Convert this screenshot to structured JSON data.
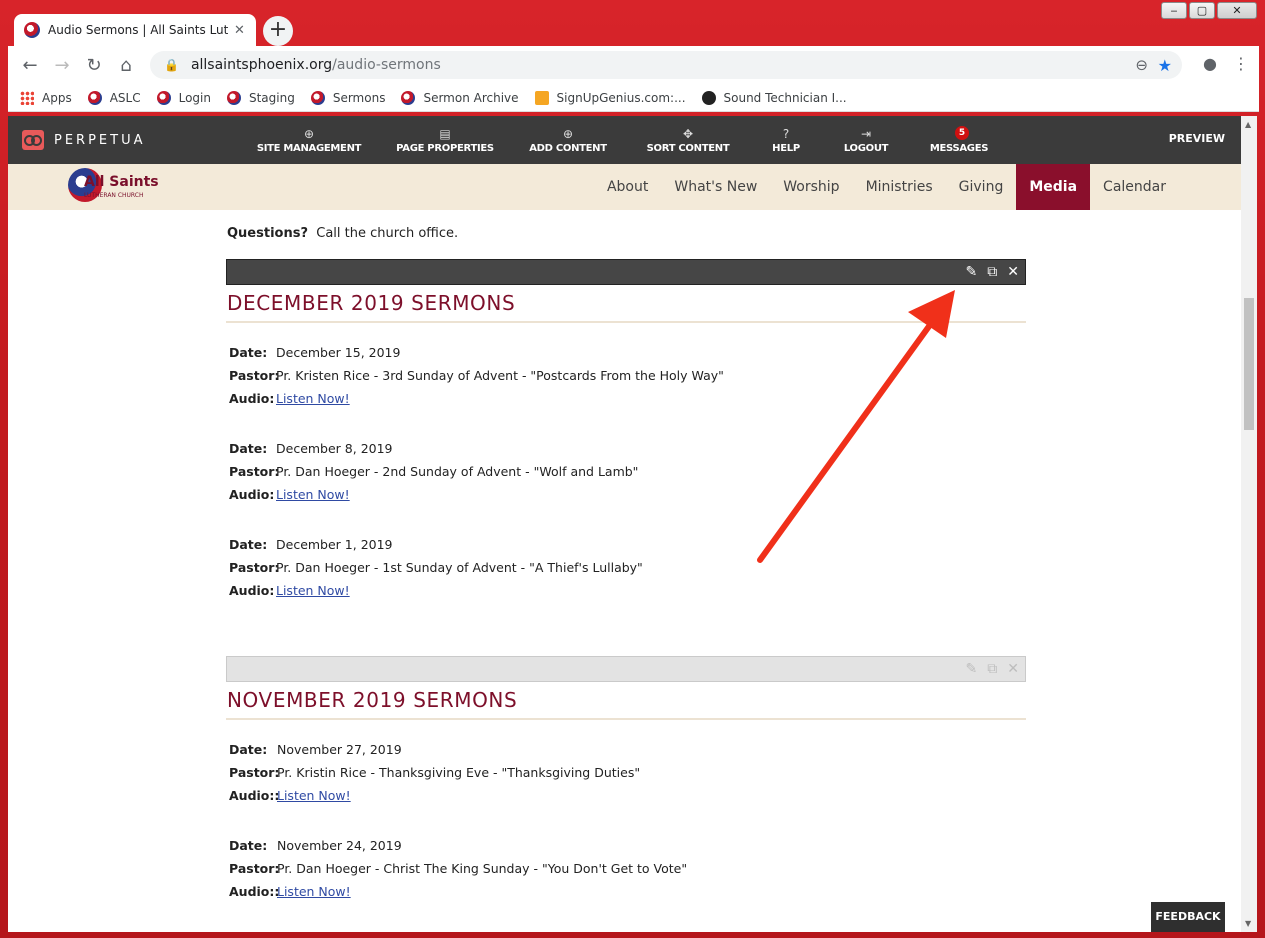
{
  "browser": {
    "tab_title": "Audio Sermons | All Saints Luthe",
    "tab_close": "✕",
    "new_tab": "+",
    "url_host": "allsaintsphoenix.org",
    "url_path": "/audio-sermons",
    "window_controls": [
      "‒",
      "▢",
      "✕"
    ],
    "bookmarks": [
      "Apps",
      "ASLC",
      "Login",
      "Staging",
      "Sermons",
      "Sermon Archive",
      "SignUpGenius.com:...",
      "Sound Technician I..."
    ]
  },
  "cms": {
    "logo_text": "PERPETUA",
    "nav": [
      {
        "icon": "⊕",
        "label": "SITE MANAGEMENT"
      },
      {
        "icon": "▤",
        "label": "PAGE PROPERTIES"
      },
      {
        "icon": "⊕",
        "label": "ADD CONTENT"
      },
      {
        "icon": "✥",
        "label": "SORT CONTENT"
      },
      {
        "icon": "?",
        "label": "HELP"
      },
      {
        "icon": "⇥",
        "label": "LOGOUT"
      },
      {
        "icon": "",
        "label": "MESSAGES",
        "badge": "5"
      }
    ],
    "preview": "PREVIEW"
  },
  "site": {
    "logo_main": "All Saints",
    "logo_sub": "LUTHERAN CHURCH",
    "menu": [
      "About",
      "What's New",
      "Worship",
      "Ministries",
      "Giving",
      "Media",
      "Calendar"
    ],
    "active_menu": "Media"
  },
  "content": {
    "questions_label": "Questions?",
    "questions_text": "Call the church office.",
    "sections": [
      {
        "title": "DECEMBER 2019 SERMONS",
        "entries": [
          {
            "date_label": "Date:",
            "date": "December 15, 2019",
            "pastor_label": "Pastor:",
            "pastor": "Pr. Kristen Rice - 3rd Sunday of Advent - \"Postcards From the Holy Way\"",
            "audio_label": "Audio:",
            "audio": "Listen Now!"
          },
          {
            "date_label": "Date:",
            "date": "December 8, 2019",
            "pastor_label": "Pastor:",
            "pastor": "Pr. Dan Hoeger - 2nd Sunday of Advent - \"Wolf and Lamb\"",
            "audio_label": "Audio:",
            "audio": "Listen Now!"
          },
          {
            "date_label": "Date:",
            "date": "December 1, 2019",
            "pastor_label": "Pastor:",
            "pastor": "Pr. Dan Hoeger - 1st Sunday of Advent - \"A Thief's Lullaby\"",
            "audio_label": "Audio:",
            "audio": "Listen Now!"
          }
        ]
      },
      {
        "title": "NOVEMBER 2019 SERMONS",
        "entries": [
          {
            "date_label": "Date:",
            "date": "November 27, 2019",
            "pastor_label": "Pastor:",
            "pastor": "Pr. Kristin Rice - Thanksgiving Eve - \"Thanksgiving Duties\"",
            "audio_label": "Audio::",
            "audio": "Listen Now!"
          },
          {
            "date_label": "Date:",
            "date": "November 24, 2019",
            "pastor_label": "Pastor:",
            "pastor": "Pr. Dan Hoeger - Christ The King Sunday - \"You Don't Get to Vote\"",
            "audio_label": "Audio::",
            "audio": "Listen Now!"
          }
        ]
      }
    ],
    "edit_icons": [
      "✎",
      "⧉",
      "✕"
    ]
  },
  "feedback": "FEEDBACK",
  "colors": {
    "accent": "#8a0f2c",
    "arrow": "#f0301a",
    "cms_bar": "#3b3b3b"
  }
}
